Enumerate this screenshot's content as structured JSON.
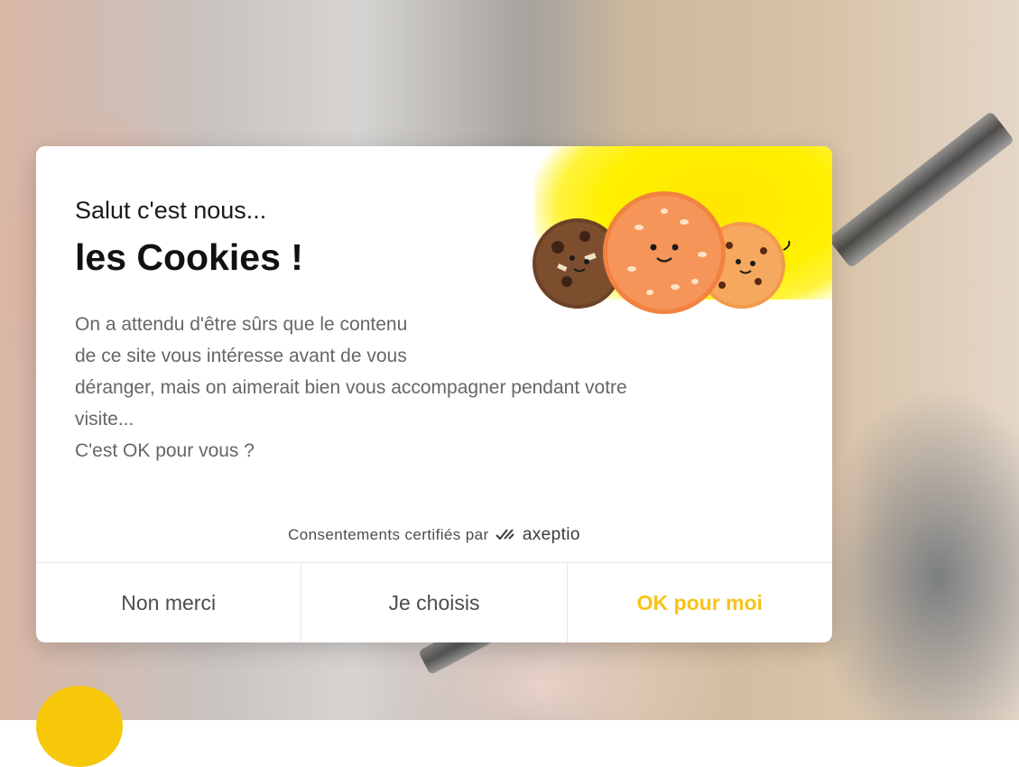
{
  "background": {
    "description_colors": {
      "accent_yellow": "#f7c80a"
    }
  },
  "cookie_banner": {
    "greeting": "Salut c'est nous...",
    "headline": "les Cookies !",
    "body_lines": [
      "On a attendu d'être sûrs que le contenu",
      "de ce site vous intéresse avant de vous",
      "déranger, mais on aimerait bien vous accompagner pendant votre",
      "visite...",
      "C'est OK pour vous ?"
    ],
    "certified_by": "Consentements certifiés par",
    "brand": "axeptio",
    "illustration": "cookies-illustration",
    "buttons": {
      "decline": "Non merci",
      "choose": "Je choisis",
      "accept": "OK pour moi"
    },
    "colors": {
      "accept_text": "#f7c31a",
      "sun_yellow": "#fff000",
      "body_text": "#666666"
    }
  }
}
